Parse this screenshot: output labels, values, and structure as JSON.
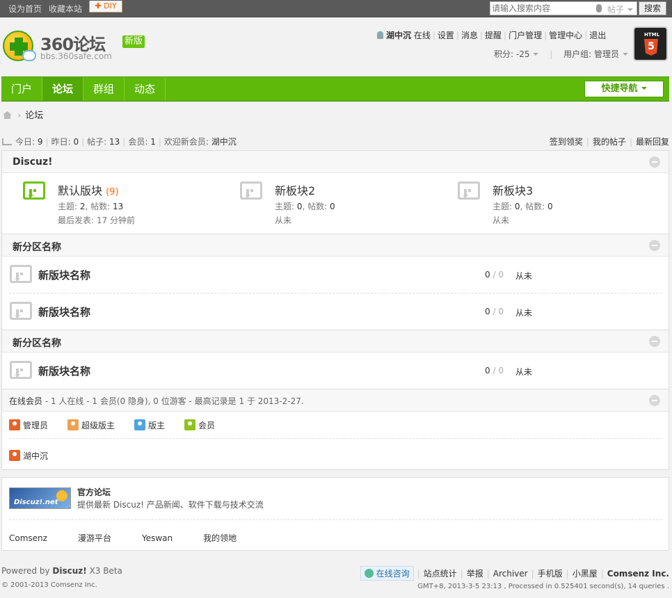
{
  "topbar": {
    "sethome": "设为首页",
    "favorite": "收藏本站",
    "diy": "DIY",
    "search_placeholder": "请输入搜索内容",
    "search_type": "帖子",
    "search_btn": "搜索"
  },
  "logo": {
    "name": "360论坛",
    "badge": "新版",
    "url": "bbs.360safe.com"
  },
  "user": {
    "name": "湖中沉",
    "status": "在线",
    "links": [
      "设置",
      "消息",
      "提醒",
      "门户管理",
      "管理中心",
      "退出"
    ],
    "credits": "积分: -25",
    "group": "用户组: 管理员"
  },
  "html5": {
    "label": "HTML",
    "num": "5"
  },
  "nav": {
    "items": [
      "门户",
      "论坛",
      "群组",
      "动态"
    ],
    "active": 1,
    "quick": "快捷导航"
  },
  "breadcrumb": {
    "current": "论坛"
  },
  "stats": {
    "today_l": "今日:",
    "today": "9",
    "yest_l": "昨日:",
    "yest": "0",
    "posts_l": "帖子:",
    "posts": "13",
    "members_l": "会员:",
    "members": "1",
    "welcome_l": "欢迎新会员:",
    "welcome": "湖中沉"
  },
  "rlinks": [
    "签到领奖",
    "我的帖子",
    "最新回复"
  ],
  "cat1": {
    "title": "Discuz!",
    "forums": [
      {
        "name": "默认版块",
        "count": "(9)",
        "meta1": "主题: ",
        "t": "2",
        "meta2": ", 帖数: ",
        "p": "13",
        "last": "最后发表: 17 分钟前"
      },
      {
        "name": "新板块2",
        "count": "",
        "meta1": "主题: ",
        "t": "0",
        "meta2": ", 帖数: ",
        "p": "0",
        "last": "从未"
      },
      {
        "name": "新板块3",
        "count": "",
        "meta1": "主题: ",
        "t": "0",
        "meta2": ", 帖数: ",
        "p": "0",
        "last": "从未"
      }
    ]
  },
  "cat2": {
    "title": "新分区名称",
    "rows": [
      {
        "name": "新版块名称",
        "a": "0",
        "b": "0",
        "last": "从未"
      },
      {
        "name": "新版块名称",
        "a": "0",
        "b": "0",
        "last": "从未"
      }
    ]
  },
  "cat3": {
    "title": "新分区名称",
    "rows": [
      {
        "name": "新版块名称",
        "a": "0",
        "b": "0",
        "last": "从未"
      }
    ]
  },
  "online": {
    "title": "在线会员",
    "desc": " - 1 人在线 - 1 会员(0 隐身), 0 位游客 - 最高记录是 1 于 2013-2-27.",
    "legend": [
      {
        "label": "管理员",
        "color": "#e8632a"
      },
      {
        "label": "超级版主",
        "color": "#f0a050"
      },
      {
        "label": "版主",
        "color": "#4fa3e0"
      },
      {
        "label": "会员",
        "color": "#8fc31f"
      }
    ],
    "user": "湖中沉"
  },
  "links": {
    "logo": "Discuz!.net",
    "title": "官方论坛",
    "desc": "提供最新 Discuz! 产品新闻、软件下载与技术交流",
    "items": [
      "Comsenz",
      "漫游平台",
      "Yeswan",
      "我的领地"
    ]
  },
  "footer": {
    "powered": "Powered by ",
    "brand": "Discuz!",
    "ver": " X3 Beta",
    "copy": "© 2001-2013 Comsenz Inc.",
    "chat": "在线咨询",
    "links": [
      "站点统计",
      "举报",
      "Archiver",
      "手机版",
      "小黑屋"
    ],
    "company": "Comsenz Inc.",
    "gmt": "GMT+8, 2013-3-5 23:13 , Processed in 0.525401 second(s), 14 queries ."
  }
}
